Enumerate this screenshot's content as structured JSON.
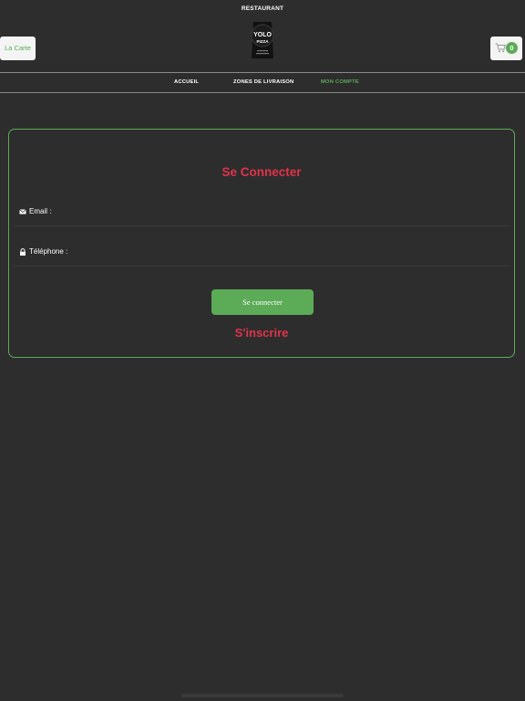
{
  "header": {
    "title": "RESTAURANT",
    "logo": {
      "icon": "yolo-pizza-logo",
      "line1": "YOLO",
      "line2": "PIZZA"
    },
    "carte_label": "La Carte",
    "cart": {
      "icon": "cart-icon",
      "count": "0"
    }
  },
  "nav": {
    "items": [
      {
        "label": "ACCUEIL",
        "active": false
      },
      {
        "label": "ZONES DE LIVRAISON",
        "active": false
      },
      {
        "label": "MON COMPTE",
        "active": true
      }
    ]
  },
  "login": {
    "title": "Se Connecter",
    "email_label": "Email :",
    "email_icon": "envelope-icon",
    "phone_label": "Téléphone :",
    "phone_icon": "lock-icon",
    "connect_label": "Se connecter",
    "signup_label": "S'inscrire"
  },
  "colors": {
    "background": "#2d2d2d",
    "accent_green": "#5cab57",
    "accent_red": "#e0334a"
  }
}
